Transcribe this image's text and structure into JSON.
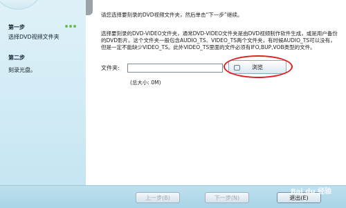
{
  "sidebar": {
    "steps": [
      {
        "title": "第一步",
        "sub": "选择DVD视频文件夹"
      },
      {
        "title": "第二步",
        "sub": "刻录光盘。"
      }
    ]
  },
  "main": {
    "hint": "请您选择要刻录的DVD视频文件夹，然后单击“下一步”继续。",
    "description": "选择要刻录的DVD-VIDEO文件夹，通常DVD-VIDEO文件夹是由DVD视频制作软件生成，或是用户备份的DVD影片。这个文件夹一般包含AUDIO_TS、VIDEO_TS两个文件夹，有时候AUDIO_TS可以没有，但是一定不能缺少VIDEO_TS。此外VIDEO_TS里面的文件必须有IFO,BUP,VOB类型的文件。",
    "folder_label": "文件夹:",
    "folder_value": "",
    "browse_label": "浏览",
    "size_text": "(总大小: 0M)"
  },
  "footer": {
    "prev_label": "上一步(B)",
    "next_label": "下一步(N)",
    "exit_label": "退出(E)"
  },
  "watermark": "Bai du 经验",
  "colors": {
    "highlight": "#e02020",
    "step_dot": "#6abf4b"
  }
}
